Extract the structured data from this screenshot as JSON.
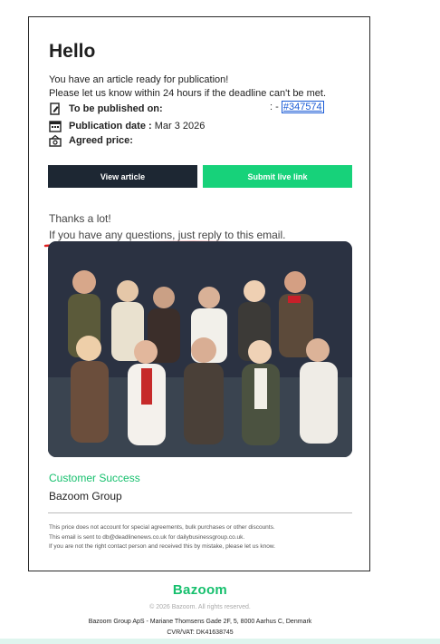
{
  "email": {
    "greeting": "Hello",
    "intro_line1": "You have an article ready for publication!",
    "intro_line2": "Please let us know within 24 hours if the deadline can't be met.",
    "published_on_label": "To be published on:",
    "reference_prefix": ": - ",
    "reference_id": "#347574",
    "publication_date_label": "Publication date :",
    "publication_date_value": "Mar 3 2026",
    "agreed_price_label": "Agreed price:",
    "view_article_button": "View article",
    "submit_link_button": "Submit live link",
    "thanks_line": "Thanks a lot!",
    "reply_line": "If you have any questions, just reply to this email.",
    "signature_department": "Customer Success",
    "signature_company": "Bazoom Group",
    "fine_print": [
      "This price does not account for special agreements, bulk purchases or other discounts.",
      "This email is sent to db@deadlinenews.co.uk for dailybusinessgroup.co.uk.",
      "If you are not the right contact person and received this by mistake, please let us know."
    ]
  },
  "footer": {
    "logo_text": "Bazoom",
    "copyright": "© 2026 Bazoom. All rights reserved.",
    "address": "Bazoom Group ApS - Mariane Thomsens Gade 2F, 5, 8000 Aarhus C, Denmark",
    "vat": "CVR/VAT: DK41638745"
  },
  "colors": {
    "accent_green": "#17d27a",
    "dark_button": "#1d2733",
    "link_blue": "#1a5bd6",
    "annotation_red": "#e02020"
  },
  "icons": [
    "document-edit-icon",
    "calendar-icon",
    "money-icon"
  ]
}
